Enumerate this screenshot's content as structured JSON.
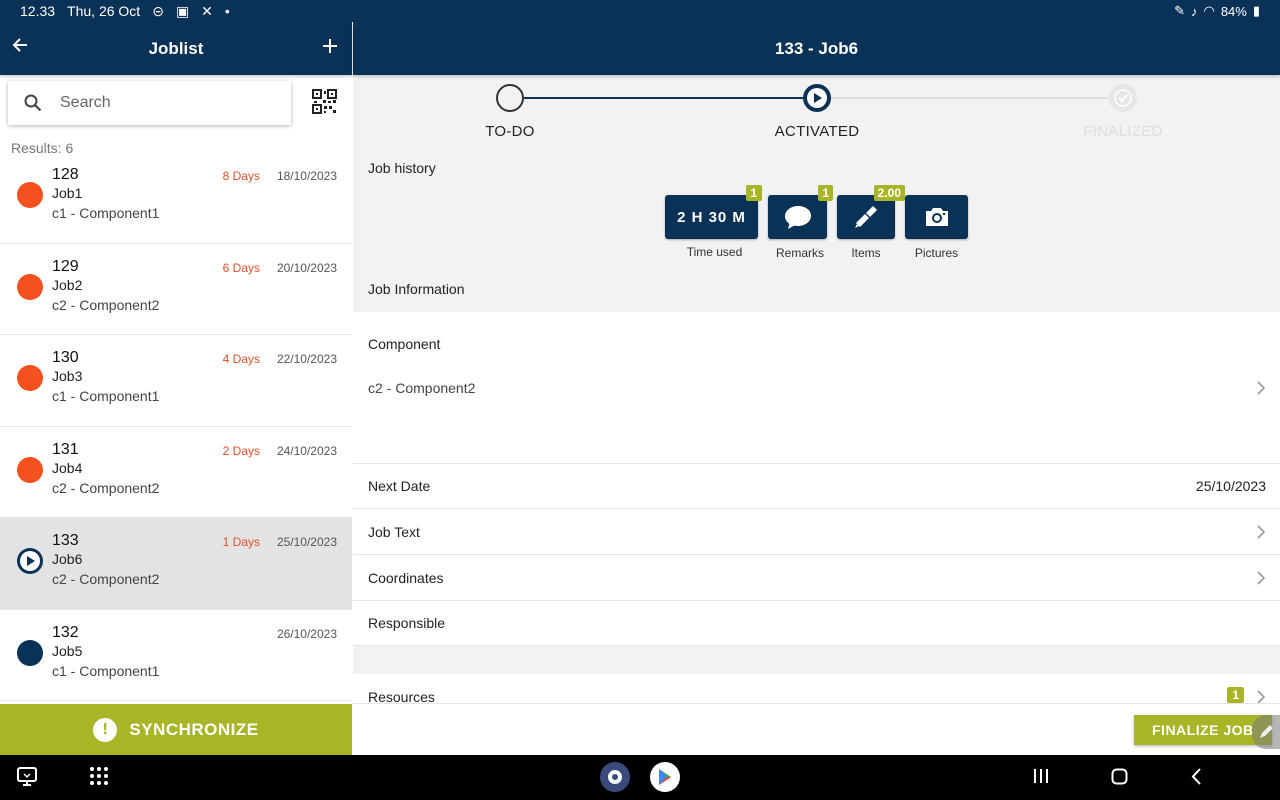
{
  "statusbar": {
    "time": "12.33",
    "date": "Thu, 26 Oct",
    "battery": "84%"
  },
  "left": {
    "title": "Joblist",
    "search_placeholder": "Search",
    "results": "Results: 6",
    "jobs": [
      {
        "number": "128",
        "name": "Job1",
        "component": "c1 - Component1",
        "days": "8 Days",
        "date": "18/10/2023",
        "status": "todo",
        "color": "#f4511e"
      },
      {
        "number": "129",
        "name": "Job2",
        "component": "c2 - Component2",
        "days": "6 Days",
        "date": "20/10/2023",
        "status": "todo",
        "color": "#f4511e"
      },
      {
        "number": "130",
        "name": "Job3",
        "component": "c1 - Component1",
        "days": "4 Days",
        "date": "22/10/2023",
        "status": "todo",
        "color": "#f4511e"
      },
      {
        "number": "131",
        "name": "Job4",
        "component": "c2 - Component2",
        "days": "2 Days",
        "date": "24/10/2023",
        "status": "todo",
        "color": "#f4511e"
      },
      {
        "number": "133",
        "name": "Job6",
        "component": "c2 - Component2",
        "days": "1 Days",
        "date": "25/10/2023",
        "status": "activated",
        "color": "#0a3257"
      },
      {
        "number": "132",
        "name": "Job5",
        "component": "c1 - Component1",
        "days": "",
        "date": "26/10/2023",
        "status": "planned",
        "color": "#0a3257"
      }
    ],
    "sync_label": "SYNCHRONIZE"
  },
  "right": {
    "title": "133 - Job6",
    "steps": [
      "TO-DO",
      "ACTIVATED",
      "FINALIZED"
    ],
    "job_history_label": "Job history",
    "history": {
      "time": {
        "value": "2 H 30 M",
        "label": "Time used",
        "badge": "1"
      },
      "remarks": {
        "label": "Remarks",
        "badge": "1"
      },
      "items": {
        "label": "Items",
        "badge": "2.00"
      },
      "pictures": {
        "label": "Pictures"
      }
    },
    "job_info_label": "Job Information",
    "component_label": "Component",
    "component_value": "c2 - Component2",
    "next_date_label": "Next Date",
    "next_date_value": "25/10/2023",
    "job_text_label": "Job Text",
    "coordinates_label": "Coordinates",
    "responsible_label": "Responsible",
    "resources_label": "Resources",
    "resources_badge": "1",
    "finalize_label": "FINALIZE JOB"
  },
  "colors": {
    "navy": "#0a3257",
    "accent": "#a8b526",
    "alert": "#e2502a"
  }
}
